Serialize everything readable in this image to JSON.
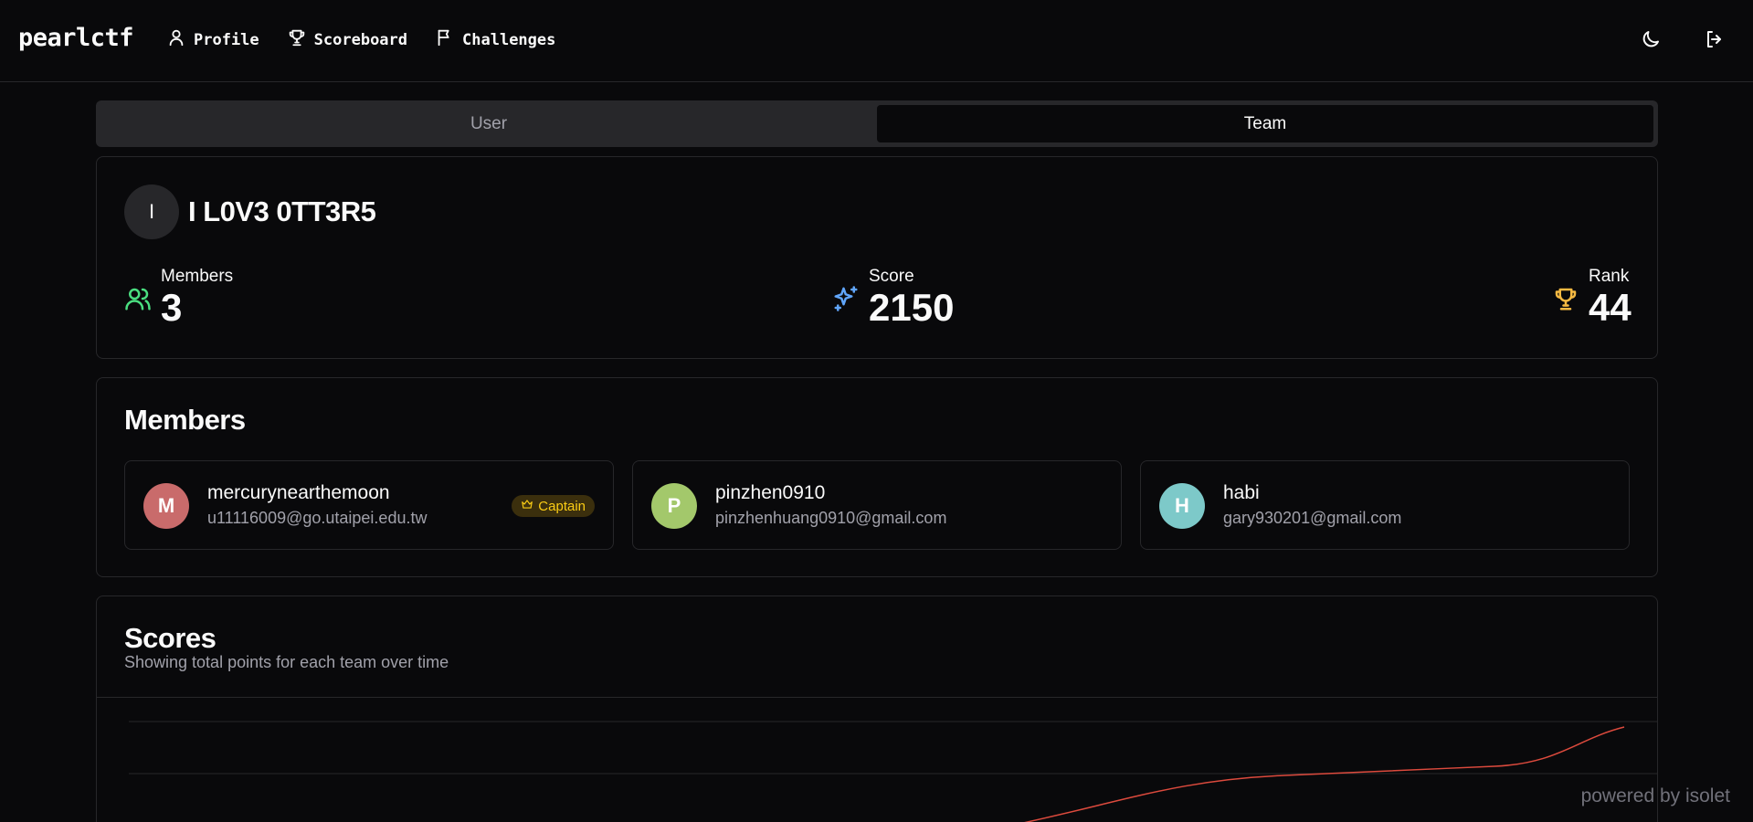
{
  "brand": "pearlctf",
  "nav": {
    "profile": "Profile",
    "scoreboard": "Scoreboard",
    "challenges": "Challenges"
  },
  "tabs": {
    "user": "User",
    "team": "Team",
    "active": "Team"
  },
  "team": {
    "avatar_letter": "I",
    "name": "I L0V3 0TT3R5",
    "members_label": "Members",
    "members_value": "3",
    "score_label": "Score",
    "score_value": "2150",
    "rank_label": "Rank",
    "rank_value": "44"
  },
  "members_section": {
    "title": "Members",
    "members": [
      {
        "initial": "M",
        "name": "mercurynearthemoon",
        "email": "u11116009@go.utaipei.edu.tw",
        "color": "#c96b6b",
        "badge": "Captain"
      },
      {
        "initial": "P",
        "name": "pinzhen0910",
        "email": "pinzhenhuang0910@gmail.com",
        "color": "#a3c86b"
      },
      {
        "initial": "H",
        "name": "habi",
        "email": "gary930201@gmail.com",
        "color": "#7dc9c9"
      }
    ]
  },
  "scores": {
    "title": "Scores",
    "subtitle": "Showing total points for each team over time",
    "line_color": "#dc4a3d"
  },
  "colors": {
    "members_icon": "#4ade80",
    "score_icon": "#60a5fa",
    "rank_icon": "#f5b942",
    "captain_badge": "#facc15"
  },
  "footer": {
    "powered": "powered by isolet"
  }
}
